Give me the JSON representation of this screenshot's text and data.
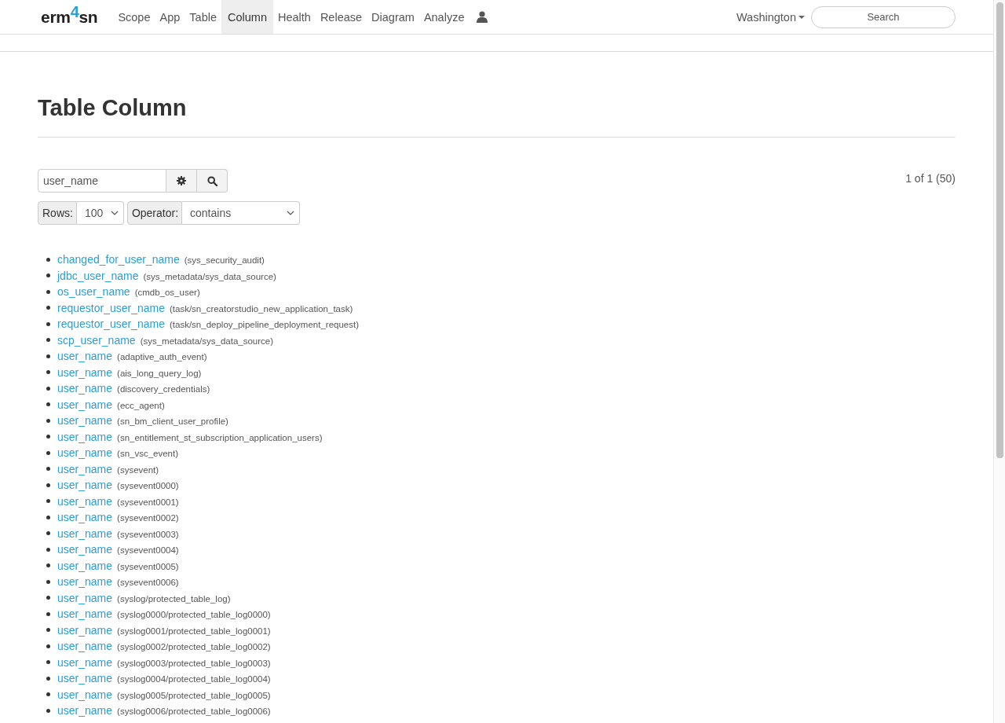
{
  "navbar": {
    "brand": {
      "left": "erm",
      "accent": "4",
      "right": "sn"
    },
    "items": [
      {
        "label": "Scope",
        "selected": false
      },
      {
        "label": "App",
        "selected": false
      },
      {
        "label": "Table",
        "selected": false
      },
      {
        "label": "Column",
        "selected": true
      },
      {
        "label": "Health",
        "selected": false
      },
      {
        "label": "Release",
        "selected": false
      },
      {
        "label": "Diagram",
        "selected": false
      },
      {
        "label": "Analyze",
        "selected": false
      }
    ],
    "release_menu": "Washington",
    "search": {
      "placeholder": "Search"
    }
  },
  "page_title": "Table Column",
  "filter": {
    "query": "user_name",
    "rows_label": "Rows:",
    "rows_value": "100",
    "operator_label": "Operator:",
    "operator_value": "contains"
  },
  "pager": "1 of 1 (50)",
  "results": [
    {
      "column": "changed_for_user_name",
      "table": "(sys_security_audit)"
    },
    {
      "column": "jdbc_user_name",
      "table": "(sys_metadata/sys_data_source)"
    },
    {
      "column": "os_user_name",
      "table": "(cmdb_os_user)"
    },
    {
      "column": "requestor_user_name",
      "table": "(task/sn_creatorstudio_new_application_task)"
    },
    {
      "column": "requestor_user_name",
      "table": "(task/sn_deploy_pipeline_deployment_request)"
    },
    {
      "column": "scp_user_name",
      "table": "(sys_metadata/sys_data_source)"
    },
    {
      "column": "user_name",
      "table": "(adaptive_auth_event)"
    },
    {
      "column": "user_name",
      "table": "(ais_long_query_log)"
    },
    {
      "column": "user_name",
      "table": "(discovery_credentials)"
    },
    {
      "column": "user_name",
      "table": "(ecc_agent)"
    },
    {
      "column": "user_name",
      "table": "(sn_bm_client_user_profile)"
    },
    {
      "column": "user_name",
      "table": "(sn_entitlement_st_subscription_application_users)"
    },
    {
      "column": "user_name",
      "table": "(sn_vsc_event)"
    },
    {
      "column": "user_name",
      "table": "(sysevent)"
    },
    {
      "column": "user_name",
      "table": "(sysevent0000)"
    },
    {
      "column": "user_name",
      "table": "(sysevent0001)"
    },
    {
      "column": "user_name",
      "table": "(sysevent0002)"
    },
    {
      "column": "user_name",
      "table": "(sysevent0003)"
    },
    {
      "column": "user_name",
      "table": "(sysevent0004)"
    },
    {
      "column": "user_name",
      "table": "(sysevent0005)"
    },
    {
      "column": "user_name",
      "table": "(sysevent0006)"
    },
    {
      "column": "user_name",
      "table": "(syslog/protected_table_log)"
    },
    {
      "column": "user_name",
      "table": "(syslog0000/protected_table_log0000)"
    },
    {
      "column": "user_name",
      "table": "(syslog0001/protected_table_log0001)"
    },
    {
      "column": "user_name",
      "table": "(syslog0002/protected_table_log0002)"
    },
    {
      "column": "user_name",
      "table": "(syslog0003/protected_table_log0003)"
    },
    {
      "column": "user_name",
      "table": "(syslog0004/protected_table_log0004)"
    },
    {
      "column": "user_name",
      "table": "(syslog0005/protected_table_log0005)"
    },
    {
      "column": "user_name",
      "table": "(syslog0006/protected_table_log0006)"
    }
  ]
}
